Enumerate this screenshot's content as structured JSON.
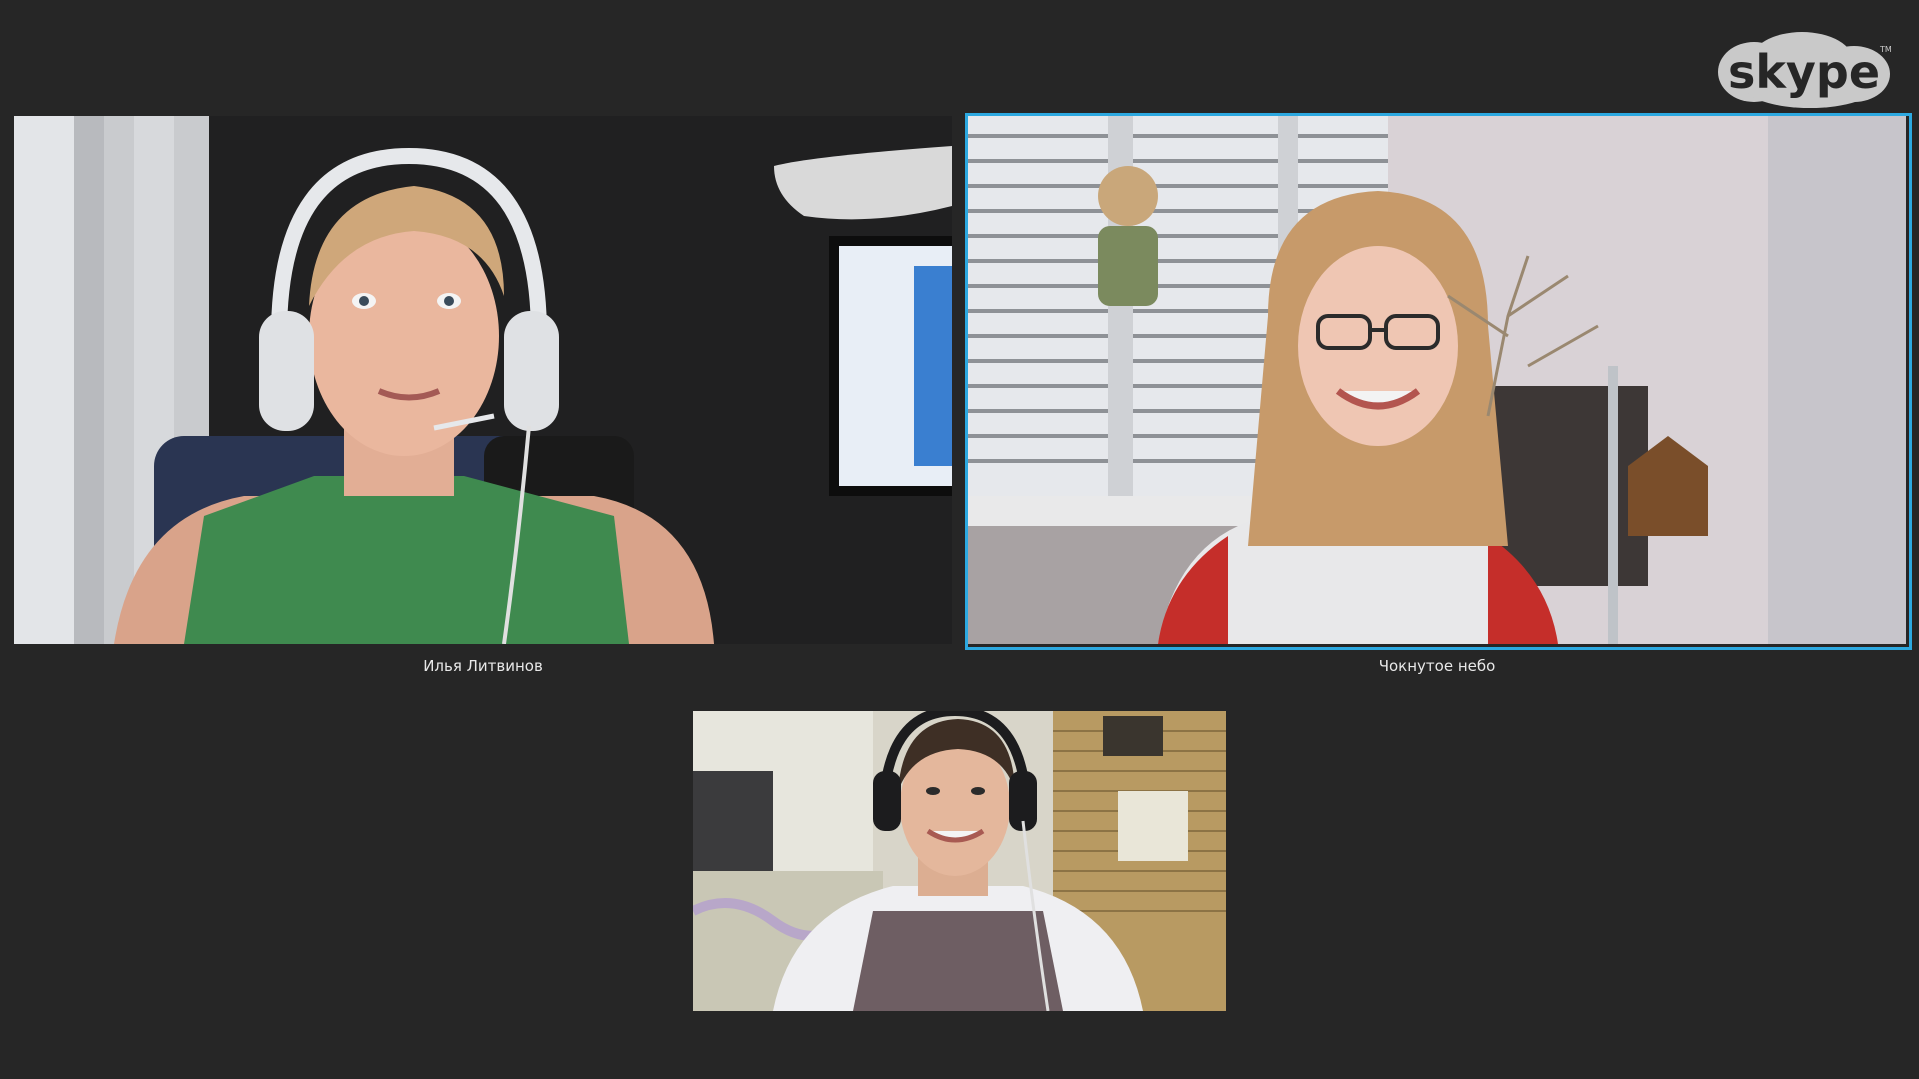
{
  "app": {
    "logo_text": "skype",
    "logo_trademark": "TM"
  },
  "participants": [
    {
      "name": "Илья Литвинов"
    },
    {
      "name": "Чокнутое небо"
    },
    {
      "name": ""
    }
  ],
  "colors": {
    "background": "#262626",
    "active_speaker_border": "#2ca8e0",
    "label_text": "#e8e8e8",
    "logo": "#c8c8c8"
  },
  "icons": {
    "logo": "skype-logo"
  }
}
